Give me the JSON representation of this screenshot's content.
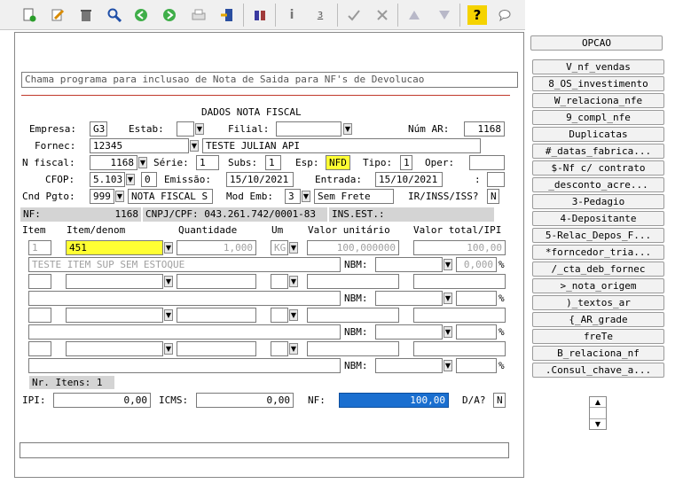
{
  "toolbar": {
    "icons": [
      "new-icon",
      "edit-icon",
      "delete-icon",
      "search-icon",
      "back-icon",
      "forward-icon",
      "print-icon",
      "export-icon",
      "binoculars-icon",
      "info-icon",
      "numbering-icon",
      "confirm-icon",
      "tools-icon",
      "up-icon",
      "down-icon",
      "help-icon",
      "chat-icon"
    ],
    "help_glyph": "?",
    "info_glyph": "i",
    "num_glyph": "3"
  },
  "option_header": "OPCAO",
  "sidebar": [
    "V_nf_vendas",
    "8_OS_investimento",
    "W_relaciona_nfe",
    "9_compl_nfe",
    "Duplicatas",
    "#_datas_fabrica...",
    "$-Nf c/ contrato",
    "_desconto_acre...",
    "3-Pedagio",
    "4-Depositante",
    "5-Relac_Depos_F...",
    "*forncedor_tria...",
    "/_cta_deb_fornec",
    ">_nota_origem",
    ")_textos_ar",
    "{_AR_grade",
    "freTe",
    "B_relaciona_nf",
    ".Consul_chave_a..."
  ],
  "description": "Chama programa para inclusao de Nota de Saida para NF's de Devolucao",
  "section_title": "DADOS NOTA FISCAL",
  "labels": {
    "empresa": "Empresa:",
    "estab": "Estab:",
    "filial": "Filial:",
    "num_ar": "Núm AR:",
    "fornec": "Fornec:",
    "nfiscal": "N fiscal:",
    "serie": "Série:",
    "subs": "Subs:",
    "esp": "Esp:",
    "tipo": "Tipo:",
    "oper": "Oper:",
    "cfop": "CFOP:",
    "emissao": "Emissão:",
    "entrada": "Entrada:",
    "colon": ":",
    "cnd_pgto": "Cnd Pgto:",
    "mod_emb": "Mod Emb:",
    "ir_inss": "IR/INSS/ISS?",
    "nbm": "NBM:",
    "pct": "%",
    "ipi": "IPI:",
    "icms": "ICMS:",
    "nf": "NF:",
    "da": "D/A?"
  },
  "values": {
    "empresa": "G3",
    "num_ar": "1168",
    "fornec": "12345",
    "fornec_name": "TESTE JULIAN API",
    "nfiscal": "1168",
    "serie": "1",
    "subs": "1",
    "esp": "NFD",
    "tipo": "1",
    "cfop": "5.103",
    "cfop_extra": "0",
    "emissao": "15/10/2021",
    "entrada": "15/10/2021",
    "cnd_pgto": "999",
    "cnd_pgto_name": "NOTA FISCAL S",
    "mod_emb": "3",
    "mod_emb_name": "Sem Frete",
    "ir_inss": "N",
    "ipi": "0,00",
    "icms": "0,00",
    "nf": "100,00",
    "da": "N"
  },
  "info_bar": {
    "nf_label": "NF:",
    "nf_value": "1168",
    "cnpj": "CNPJ/CPF: 043.261.742/0001-83",
    "ins_est": "INS.EST.:"
  },
  "items_header": [
    "Item",
    "Item/denom",
    "Quantidade",
    "Um",
    "Valor unitário",
    "Valor total/IPI"
  ],
  "item_row": {
    "item": "1",
    "code": "451",
    "quantidade": "1,000",
    "um": "KG",
    "valor_unitario": "100,000000",
    "valor_total": "100,00",
    "description": "TESTE ITEM SUP SEM ESTOQUE",
    "ipi_pct": "0,000"
  },
  "nr_itens": "Nr. Itens: 1",
  "colors": {
    "highlight": "#ffff33",
    "selected": "#1a6fd0",
    "info_gray": "#d4d4d4",
    "divider": "#c0392b"
  }
}
